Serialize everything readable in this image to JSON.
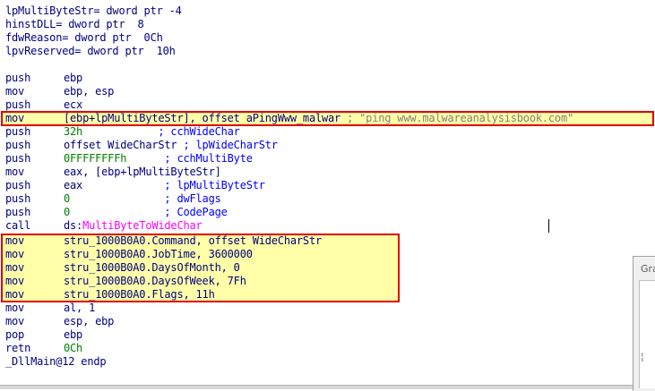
{
  "vars": [
    {
      "name": "lpMultiByteStr",
      "def": "= dword ptr -4"
    },
    {
      "name": "hinstDLL",
      "def": "= dword ptr  8"
    },
    {
      "name": "fdwReason",
      "def": "= dword ptr  0Ch"
    },
    {
      "name": "lpvReserved",
      "def": "= dword ptr  10h"
    }
  ],
  "code": [
    {
      "op": "push",
      "arg": "ebp",
      "cmt": ""
    },
    {
      "op": "mov",
      "arg": "ebp, esp",
      "cmt": ""
    },
    {
      "op": "push",
      "arg": "ecx",
      "cmt": ""
    },
    {
      "op": "mov",
      "arg": "[ebp+lpMultiByteStr], offset aPingWww_malwar ",
      "cmt": "; \"ping www.malwareanalysisbook.com\""
    },
    {
      "op": "push",
      "arg": "32h            ",
      "cmt": "; cchWideChar"
    },
    {
      "op": "push",
      "arg": "offset WideCharStr ",
      "cmt": "; lpWideCharStr"
    },
    {
      "op": "push",
      "arg": "0FFFFFFFFh      ",
      "cmt": "; cchMultiByte"
    },
    {
      "op": "mov",
      "arg": "eax, [ebp+lpMultiByteStr]",
      "cmt": ""
    },
    {
      "op": "push",
      "arg": "eax             ",
      "cmt": "; lpMultiByteStr"
    },
    {
      "op": "push",
      "arg": "0               ",
      "cmt": "; dwFlags"
    },
    {
      "op": "push",
      "arg": "0               ",
      "cmt": "; CodePage"
    },
    {
      "op": "call",
      "arg": "ds:",
      "imp": "MultiByteToWideChar",
      "cmt": ""
    },
    {
      "op": "mov",
      "arg": "stru_1000B0A0.Command, offset WideCharStr",
      "cmt": ""
    },
    {
      "op": "mov",
      "arg": "stru_1000B0A0.JobTime, 3600000",
      "cmt": ""
    },
    {
      "op": "mov",
      "arg": "stru_1000B0A0.DaysOfMonth, 0",
      "cmt": ""
    },
    {
      "op": "mov",
      "arg": "stru_1000B0A0.DaysOfWeek, 7Fh",
      "cmt": ""
    },
    {
      "op": "mov",
      "arg": "stru_1000B0A0.Flags, 11h",
      "cmt": ""
    },
    {
      "op": "mov",
      "arg": "al, 1",
      "cmt": ""
    },
    {
      "op": "mov",
      "arg": "esp, ebp",
      "cmt": ""
    },
    {
      "op": "pop",
      "arg": "ebp",
      "cmt": ""
    },
    {
      "op": "retn",
      "arg": "0Ch",
      "cmt": ""
    }
  ],
  "endp": "_DllMain@12 endp",
  "graph_panel": {
    "title": "Gra",
    "mark": "¦"
  },
  "colors": {
    "highlight_fill": "#ffffa8",
    "highlight_border": "#e00000",
    "code_text": "#000080",
    "comment": "#0000ff",
    "import": "#ff00ff"
  }
}
